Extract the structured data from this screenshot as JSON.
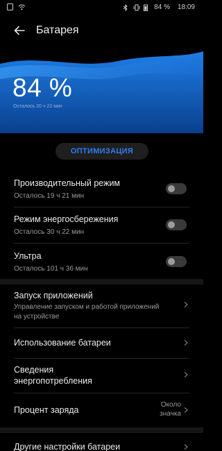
{
  "status": {
    "battery": "84 %",
    "time": "18:09"
  },
  "header": {
    "title": "Батарея"
  },
  "hero": {
    "percent": "84 %",
    "remaining": "Осталось 20 ч 22 мин",
    "gradient_top": "#2a8ef0",
    "gradient_bottom": "#0a3e8c"
  },
  "optimize": {
    "label": "ОПТИМИЗАЦИЯ",
    "color": "#2f7df0"
  },
  "modes": [
    {
      "title": "Производительный режим",
      "subtitle": "Осталось 19 ч 21 мин",
      "enabled": false
    },
    {
      "title": "Режим энергосбережения",
      "subtitle": "Осталось 30 ч 22 мин",
      "enabled": false
    },
    {
      "title": "Ультра",
      "subtitle": "Осталось 101 ч 36 мин",
      "enabled": false
    }
  ],
  "settings": [
    {
      "title": "Запуск приложений",
      "subtitle": "Управление запуском и работой приложений на устройстве"
    },
    {
      "title": "Использование батареи"
    },
    {
      "title": "Сведения энергопотребления"
    },
    {
      "title": "Процент заряда",
      "value": "Около значка"
    },
    {
      "title": "Другие настройки батареи"
    }
  ]
}
